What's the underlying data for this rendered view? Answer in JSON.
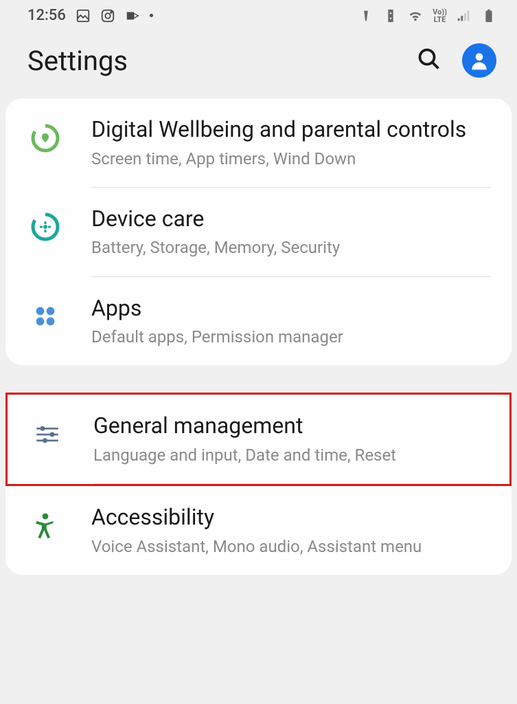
{
  "statusBar": {
    "time": "12:56"
  },
  "header": {
    "title": "Settings"
  },
  "group1": {
    "items": [
      {
        "title": "Digital Wellbeing and parental controls",
        "subtitle": "Screen time, App timers, Wind Down"
      },
      {
        "title": "Device care",
        "subtitle": "Battery, Storage, Memory, Security"
      },
      {
        "title": "Apps",
        "subtitle": "Default apps, Permission manager"
      }
    ]
  },
  "group2": {
    "items": [
      {
        "title": "General management",
        "subtitle": "Language and input, Date and time, Reset"
      },
      {
        "title": "Accessibility",
        "subtitle": "Voice Assistant, Mono audio, Assistant menu"
      }
    ]
  }
}
